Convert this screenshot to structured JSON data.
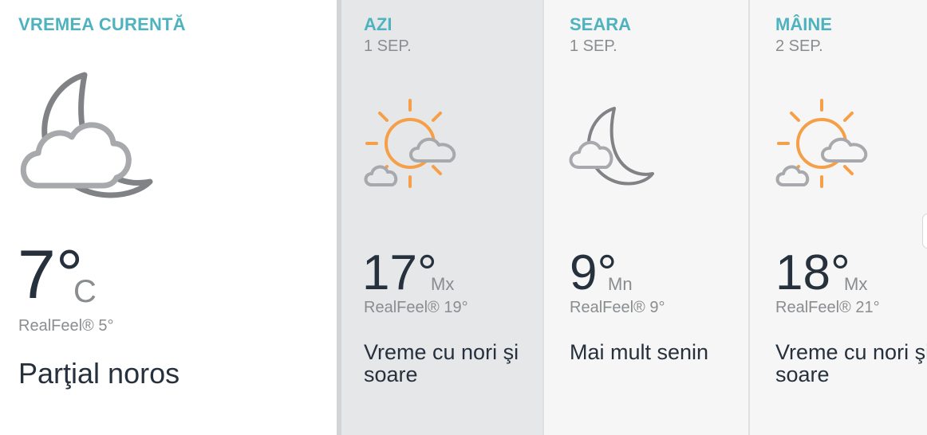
{
  "current": {
    "title": "VREMEA CURENTĂ",
    "icon": "moon-partly-cloudy-icon",
    "temp": "7°",
    "unit": "C",
    "realfeel": "RealFeel® 5°",
    "condition": "Parţial noros"
  },
  "forecast": [
    {
      "title": "AZI",
      "date": "1 SEP.",
      "icon": "sun-clouds-icon",
      "temp": "17°",
      "suffix": "Mx",
      "realfeel": "RealFeel® 19°",
      "condition": "Vreme cu nori şi soare",
      "selected": true
    },
    {
      "title": "SEARA",
      "date": "1 SEP.",
      "icon": "moon-cloud-icon",
      "temp": "9°",
      "suffix": "Mn",
      "realfeel": "RealFeel® 9°",
      "condition": "Mai mult senin",
      "selected": false
    },
    {
      "title": "MÂINE",
      "date": "2 SEP.",
      "icon": "sun-clouds-icon",
      "temp": "18°",
      "suffix": "Mx",
      "realfeel": "RealFeel® 21°",
      "condition": "Vreme cu nori şi soare",
      "selected": false
    }
  ],
  "colors": {
    "accent": "#4fb3bf",
    "text_dark": "#26313d",
    "text_muted": "#8a8d90",
    "sun": "#f5a048",
    "cloud_gray": "#a7a9ac",
    "moon_gray": "#808285",
    "selected_bg": "#e6e7e8"
  }
}
